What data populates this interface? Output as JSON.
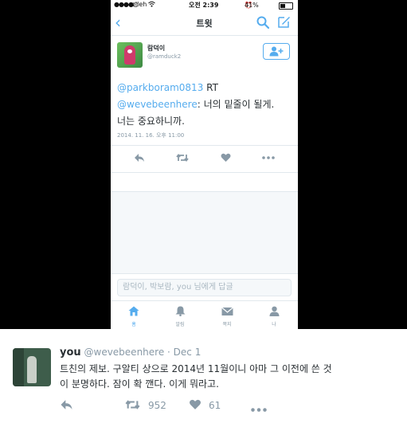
{
  "status_bar": {
    "signal": "●●●●○",
    "carrier": "olleh",
    "time": "오전 2:39",
    "battery": "41%",
    "battery_level": 0.41
  },
  "nav": {
    "title": "트윗"
  },
  "tweet": {
    "display_name": "람덕이",
    "handle": "@ramduck2",
    "mention1": "@parkboram0813",
    "rt": " RT",
    "mention2": "@wevebeenhere",
    "text_line1": ": 너의 밑줄이 될게.",
    "text_line2": "너는 중요하니까.",
    "date": "2014. 11. 16. 오후 11:00"
  },
  "reply": {
    "placeholder": "람덕이, 박보람, you 님에게 답글"
  },
  "tabs": [
    {
      "label": "홈"
    },
    {
      "label": "알림"
    },
    {
      "label": "쪽지"
    },
    {
      "label": "나"
    }
  ],
  "bottom_tweet": {
    "name": "you",
    "handle": "@wevebeenhere",
    "sep": " · ",
    "date": "Dec 1",
    "line1": "트친의 제보. 구알티 상으로 2014년 11월이니 아마 그 이전에 쓴 것",
    "line2": "이 분명하다. 잠이 확 깬다. 이게 뭐라고.",
    "retweets": "952",
    "likes": "61"
  },
  "colors": {
    "accent": "#55acee",
    "text": "#292f33",
    "muted": "#8899a6"
  }
}
